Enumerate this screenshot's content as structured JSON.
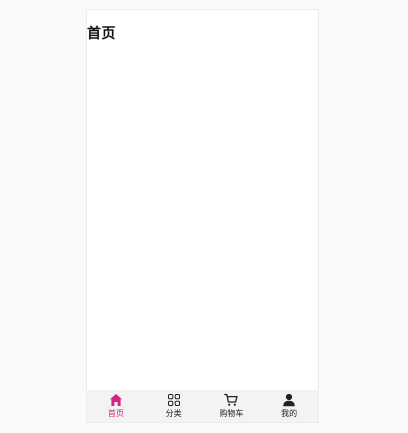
{
  "page": {
    "title": "首页"
  },
  "tabbar": {
    "active_color": "#d6247f",
    "inactive_color": "#222222",
    "items": [
      {
        "label": "首页",
        "icon": "home-icon",
        "active": true
      },
      {
        "label": "分类",
        "icon": "grid-icon",
        "active": false
      },
      {
        "label": "购物车",
        "icon": "cart-icon",
        "active": false
      },
      {
        "label": "我的",
        "icon": "user-icon",
        "active": false
      }
    ]
  }
}
